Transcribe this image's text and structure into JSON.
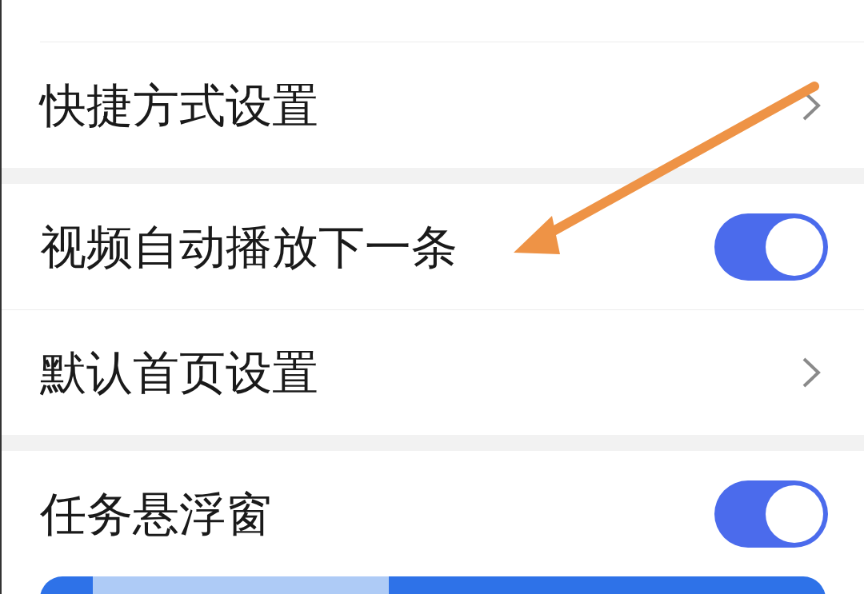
{
  "groups": [
    {
      "rows": [
        {
          "label": "快捷方式设置",
          "kind": "link"
        }
      ]
    },
    {
      "rows": [
        {
          "label": "视频自动播放下一条",
          "kind": "toggle",
          "on": true
        },
        {
          "label": "默认首页设置",
          "kind": "link"
        }
      ]
    },
    {
      "rows": [
        {
          "label": "任务悬浮窗",
          "kind": "toggle",
          "on": true
        }
      ]
    }
  ]
}
